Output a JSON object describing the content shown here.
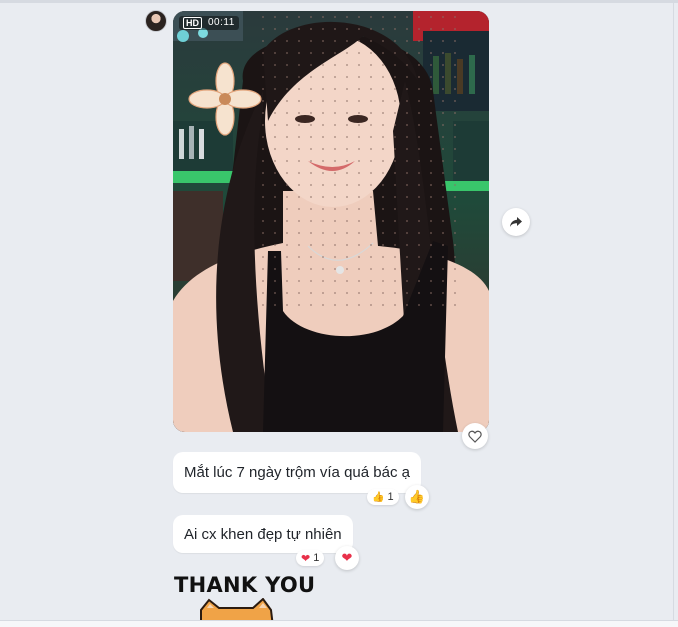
{
  "video": {
    "hd_label": "HD",
    "duration": "00:11"
  },
  "messages": [
    {
      "text": "Mắt lúc 7 ngày trộm vía quá bác ạ",
      "reaction_icon": "thumbs-up",
      "reaction_count": "1"
    },
    {
      "text": "Ai cx khen đẹp tự nhiên",
      "reaction_icon": "heart",
      "reaction_count": "1"
    }
  ],
  "sticker": {
    "text": "THANK YOU",
    "icon": "cat-sticker"
  },
  "icons": {
    "share": "share-forward-icon",
    "like": "heart-outline-icon"
  },
  "colors": {
    "background": "#e9ecf1",
    "bubble": "#ffffff",
    "heart": "#e8304a",
    "thumbs": "#f5b234"
  }
}
